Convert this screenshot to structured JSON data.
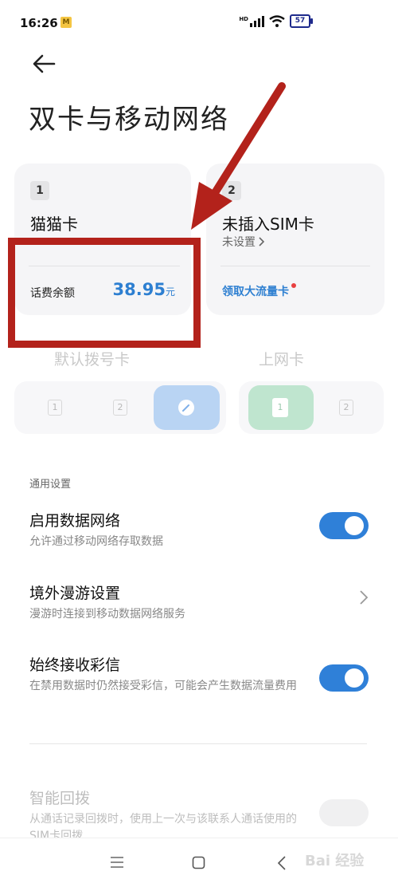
{
  "status": {
    "time": "16:26",
    "app_badge": "M",
    "signal_label": "HD",
    "battery": "57"
  },
  "header": {
    "title": "双卡与移动网络"
  },
  "sim_cards": [
    {
      "slot": "1",
      "name": "猫猫卡",
      "balance_label": "话费余额",
      "balance_value": "38.95",
      "balance_unit": "元"
    },
    {
      "slot": "2",
      "name": "未插入SIM卡",
      "status": "未设置",
      "promo_link": "领取大流量卡"
    }
  ],
  "selectors": {
    "default_dial": {
      "title": "默认拨号卡",
      "options": [
        "1",
        "2"
      ]
    },
    "data_sim": {
      "title": "上网卡",
      "options": [
        "1",
        "2"
      ]
    }
  },
  "settings": {
    "section_label": "通用设置",
    "items": [
      {
        "title": "启用数据网络",
        "desc": "允许通过移动网络存取数据",
        "toggle": true
      },
      {
        "title": "境外漫游设置",
        "desc": "漫游时连接到移动数据网络服务"
      },
      {
        "title": "始终接收彩信",
        "desc": "在禁用数据时仍然接受彩信，可能会产生数据流量费用",
        "toggle": true
      },
      {
        "title": "智能回拨",
        "desc": "从通话记录回拨时，使用上一次与该联系人通话使用的SIM卡回拨",
        "toggle": false,
        "disabled": true
      }
    ]
  },
  "watermark": "Bai 经验",
  "colors": {
    "accent": "#2f80d8",
    "annotation": "#b3221b"
  }
}
